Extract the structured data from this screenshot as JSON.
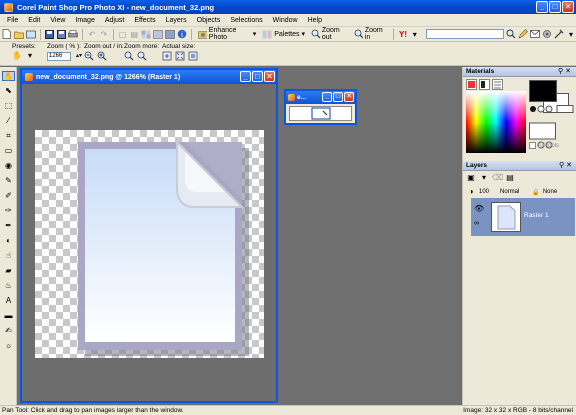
{
  "window": {
    "title": "Corel Paint Shop Pro Photo XI - new_document_32.png",
    "min": "_",
    "max": "□",
    "close": "✕"
  },
  "menu": [
    "File",
    "Edit",
    "View",
    "Image",
    "Adjust",
    "Effects",
    "Layers",
    "Objects",
    "Selections",
    "Window",
    "Help"
  ],
  "toolbar": {
    "enhance_photo": "Enhance Photo",
    "palettes": "Palettes",
    "zoom_out": "Zoom out",
    "zoom_in": "Zoom in",
    "dropdown_arrow": "▾"
  },
  "tool_options": {
    "presets_label": "Presets:",
    "zoom_label": "Zoom ( % ):",
    "zoom_value": "1266",
    "zoom_out_in_label": "Zoom out / in:",
    "zoom_more_label": "Zoom more:",
    "actual_size_label": "Actual size:"
  },
  "image_window": {
    "title": "new_document_32.png @ 1266% (Raster 1)"
  },
  "overview_window": {
    "title": "e..."
  },
  "materials": {
    "title": "Materials",
    "all_tools": "All tools",
    "fg_color": "#000000",
    "bg_color": "#ffffff"
  },
  "layers": {
    "title": "Layers",
    "opacity": "100",
    "blend_mode": "Normal",
    "lock": "None",
    "items": [
      {
        "name": "Raster 1"
      }
    ]
  },
  "status": {
    "left": "Pan Tool: Click and drag to pan images larger than the window.",
    "right": "Image:  32 x 32 x RGB - 8 bits/channel"
  }
}
